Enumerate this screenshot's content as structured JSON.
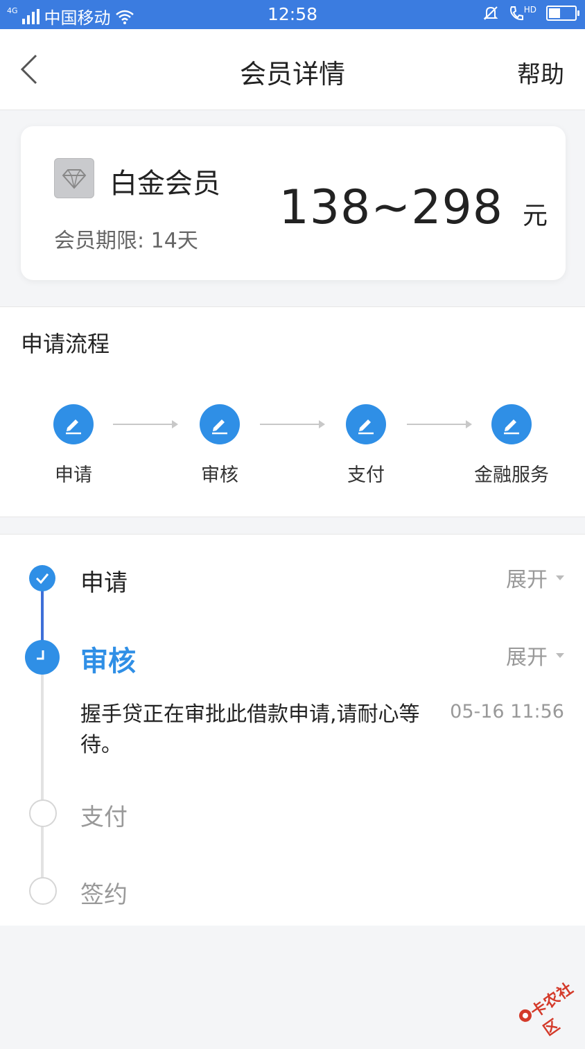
{
  "status_bar": {
    "network": "4G",
    "carrier": "中国移动",
    "time": "12:58",
    "hd_label": "HD",
    "battery_level": 0.4
  },
  "navbar": {
    "title": "会员详情",
    "help_label": "帮助",
    "back_icon": "chevron-left-icon"
  },
  "membership": {
    "icon": "diamond-icon",
    "name": "白金会员",
    "term": "会员期限: 14天",
    "price": "138~298",
    "unit": "元"
  },
  "process": {
    "title": "申请流程",
    "steps": [
      {
        "label": "申请",
        "icon": "pencil-icon"
      },
      {
        "label": "审核",
        "icon": "pencil-icon"
      },
      {
        "label": "支付",
        "icon": "pencil-icon"
      },
      {
        "label": "金融服务",
        "icon": "pencil-icon"
      }
    ]
  },
  "timeline": {
    "items": [
      {
        "label": "申请",
        "state": "done",
        "expand_label": "展开"
      },
      {
        "label": "审核",
        "state": "current",
        "expand_label": "展开",
        "description": "握手贷正在审批此借款申请,请耐心等待。",
        "time": "05-16 11:56"
      },
      {
        "label": "支付",
        "state": "pending"
      },
      {
        "label": "签约",
        "state": "pending"
      }
    ]
  },
  "watermark": {
    "text": "卡农社区"
  },
  "colors": {
    "status_bar": "#3b7ce0",
    "accent": "#2f8fe6",
    "timeline_done": "#3e6fd8",
    "text_muted": "#999999"
  }
}
